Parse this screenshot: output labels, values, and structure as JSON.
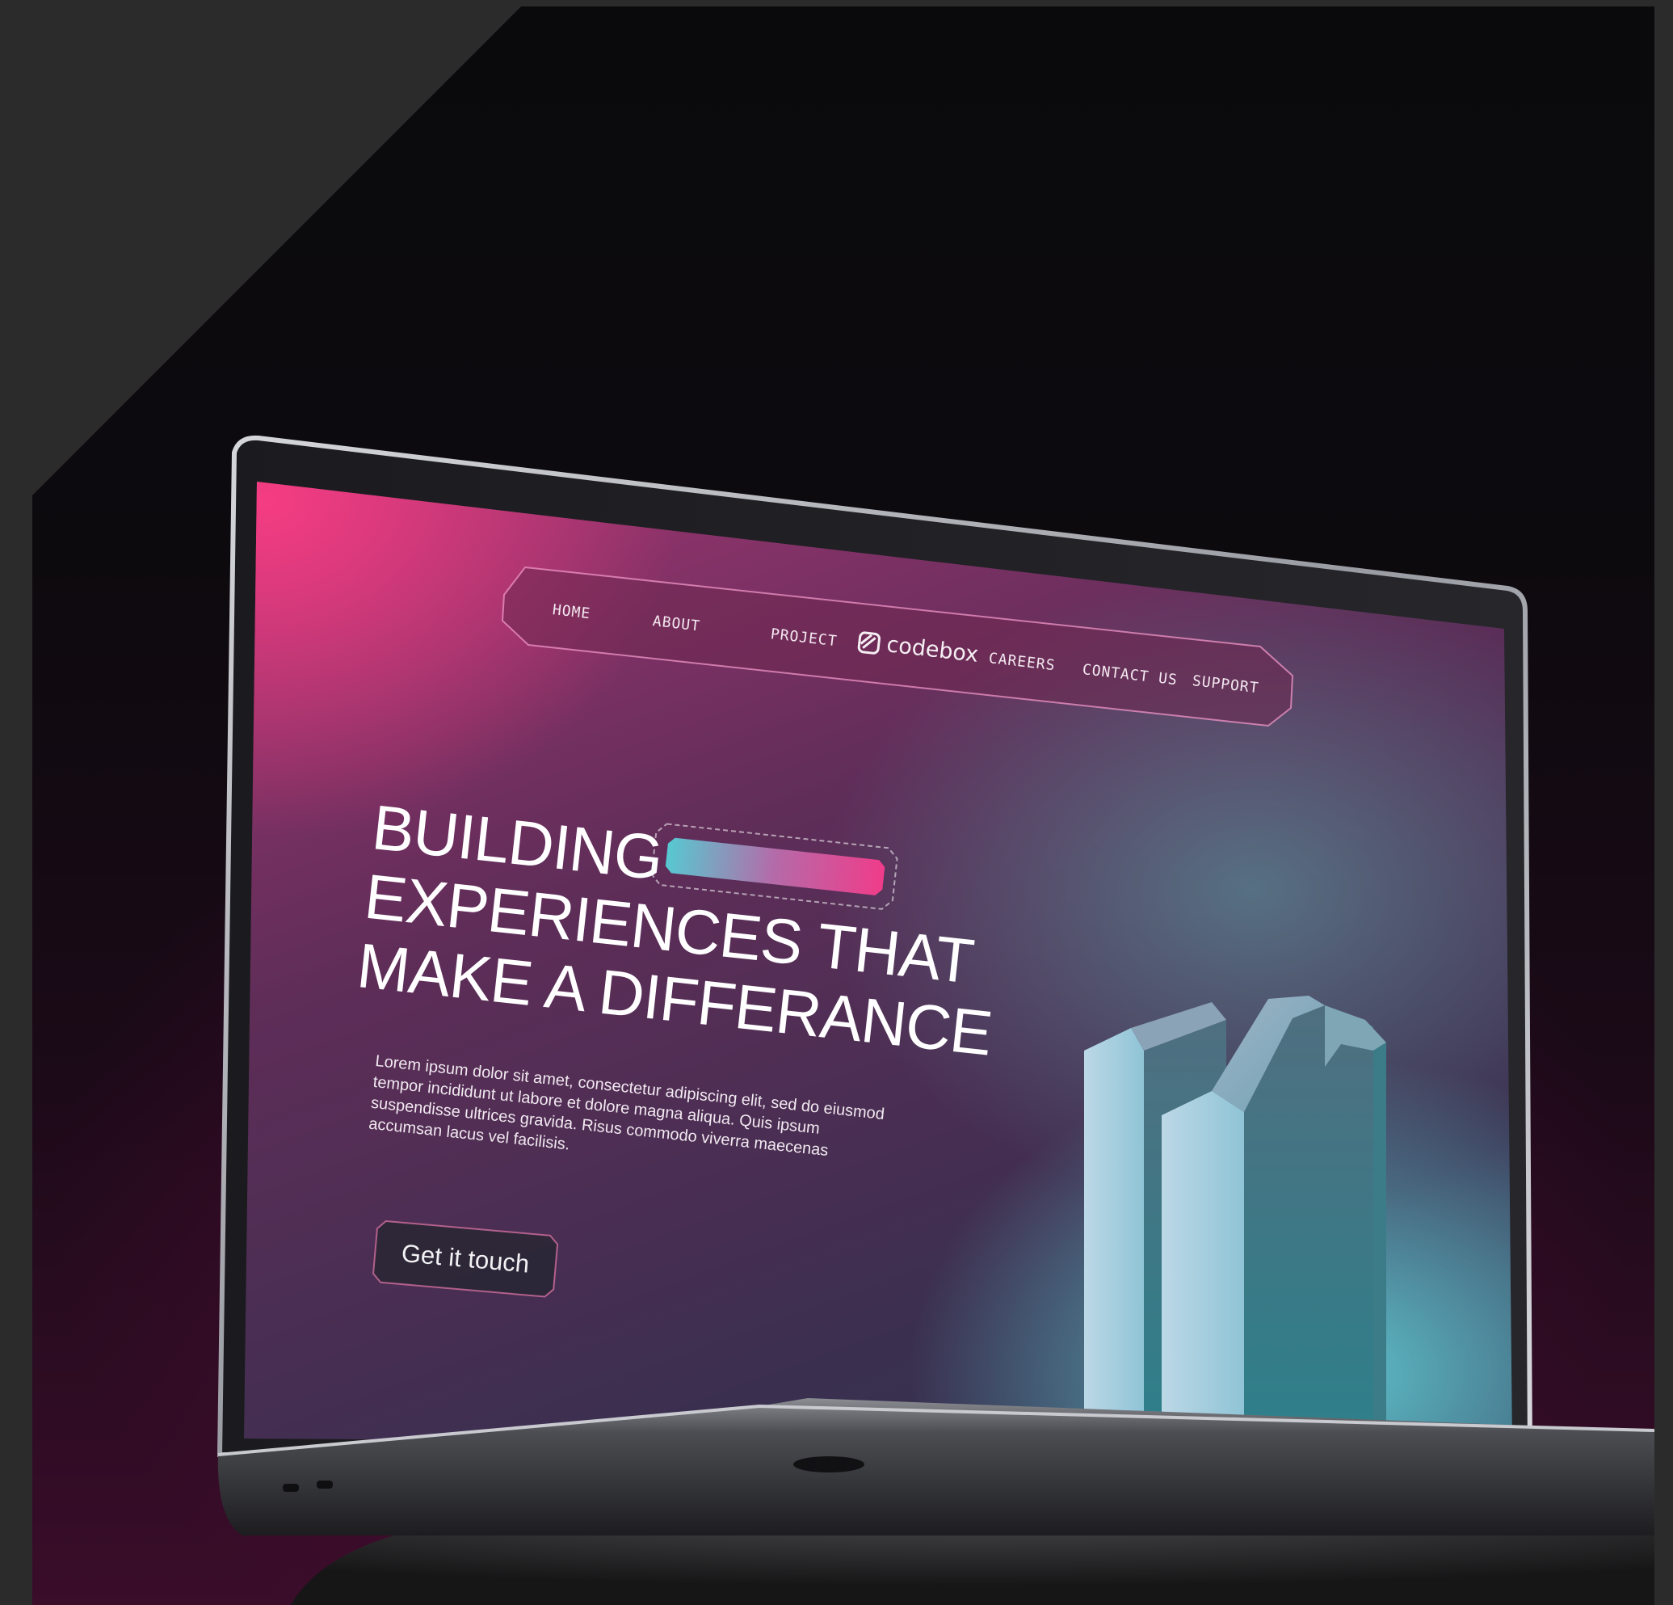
{
  "nav": {
    "items": [
      {
        "label": "HOME"
      },
      {
        "label": "ABOUT"
      },
      {
        "label": "PROJECT"
      },
      {
        "label": "CAREERS"
      },
      {
        "label": "CONTACT US"
      },
      {
        "label": "SUPPORT"
      }
    ],
    "logo_text": "codebox"
  },
  "hero": {
    "title_lines": [
      "BUILDING",
      "EXPERIENCES THAT",
      "MAKE A DIFFERANCE"
    ],
    "body": "Lorem ipsum dolor sit amet, consectetur adipiscing elit, sed do eiusmod tempor incididunt ut labore et dolore magna aliqua. Quis ipsum suspendisse ultrices gravida. Risus commodo viverra maecenas accumsan lacus vel facilisis.",
    "cta_label": "Get it touch"
  },
  "colors": {
    "pink": "#e23d84",
    "teal": "#60c8d2",
    "dark": "#0b0a0d"
  }
}
